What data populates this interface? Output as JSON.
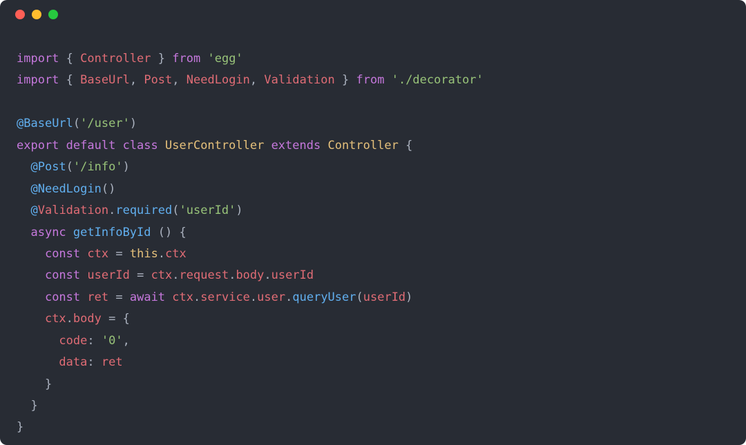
{
  "window": {
    "traffic_lights": {
      "red": "#ff5f56",
      "yellow": "#ffbd2e",
      "green": "#27c93f"
    }
  },
  "t": {
    "import": "import",
    "export": "export",
    "default": "default",
    "class": "class",
    "extends": "extends",
    "from": "from",
    "async": "async",
    "await": "await",
    "const": "const",
    "this": "this",
    "lb": "{",
    "rb": "}",
    "lp": "(",
    "rp": ")",
    "comma": ",",
    "dot": ".",
    "at": "@",
    "eq": "=",
    "colon": ":",
    "Controller": "Controller",
    "BaseUrl": "BaseUrl",
    "Post": "Post",
    "NeedLogin": "NeedLogin",
    "Validation": "Validation",
    "UserController": "UserController",
    "getInfoById": "getInfoById",
    "ctx": "ctx",
    "userId_id": "userId",
    "ret": "ret",
    "request": "request",
    "body": "body",
    "service": "service",
    "user": "user",
    "queryUser": "queryUser",
    "required": "required",
    "code": "code",
    "data": "data",
    "s_egg": "'egg'",
    "s_decorator": "'./decorator'",
    "s_user": "'/user'",
    "s_info": "'/info'",
    "s_userId": "'userId'",
    "s_zero": "'0'",
    "sp": " ",
    "ind1": "  ",
    "ind2": "    ",
    "ind3": "      "
  }
}
